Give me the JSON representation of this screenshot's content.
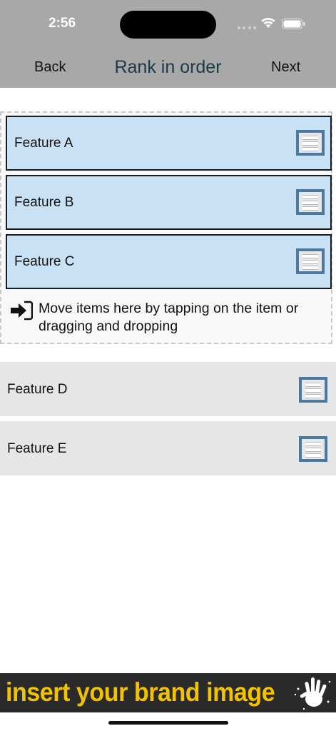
{
  "status_bar": {
    "time": "2:56"
  },
  "nav": {
    "back_label": "Back",
    "title": "Rank in order",
    "next_label": "Next"
  },
  "ranked_items": [
    {
      "label": "Feature A"
    },
    {
      "label": "Feature B"
    },
    {
      "label": "Feature C"
    }
  ],
  "drop_hint": {
    "text": "Move items here by tapping on the item or dragging and dropping",
    "icon": "move-in-icon"
  },
  "unranked_items": [
    {
      "label": "Feature D"
    },
    {
      "label": "Feature E"
    }
  ],
  "banner": {
    "text": "insert your brand image",
    "icon": "hand-print-icon"
  },
  "colors": {
    "header_bg": "#a8a8a8",
    "title_color": "#1d3b45",
    "ranked_bg": "#c9e1f5",
    "unranked_bg": "#e6e6e6",
    "handle_border": "#4a7aa2",
    "banner_text": "#f2c200"
  }
}
